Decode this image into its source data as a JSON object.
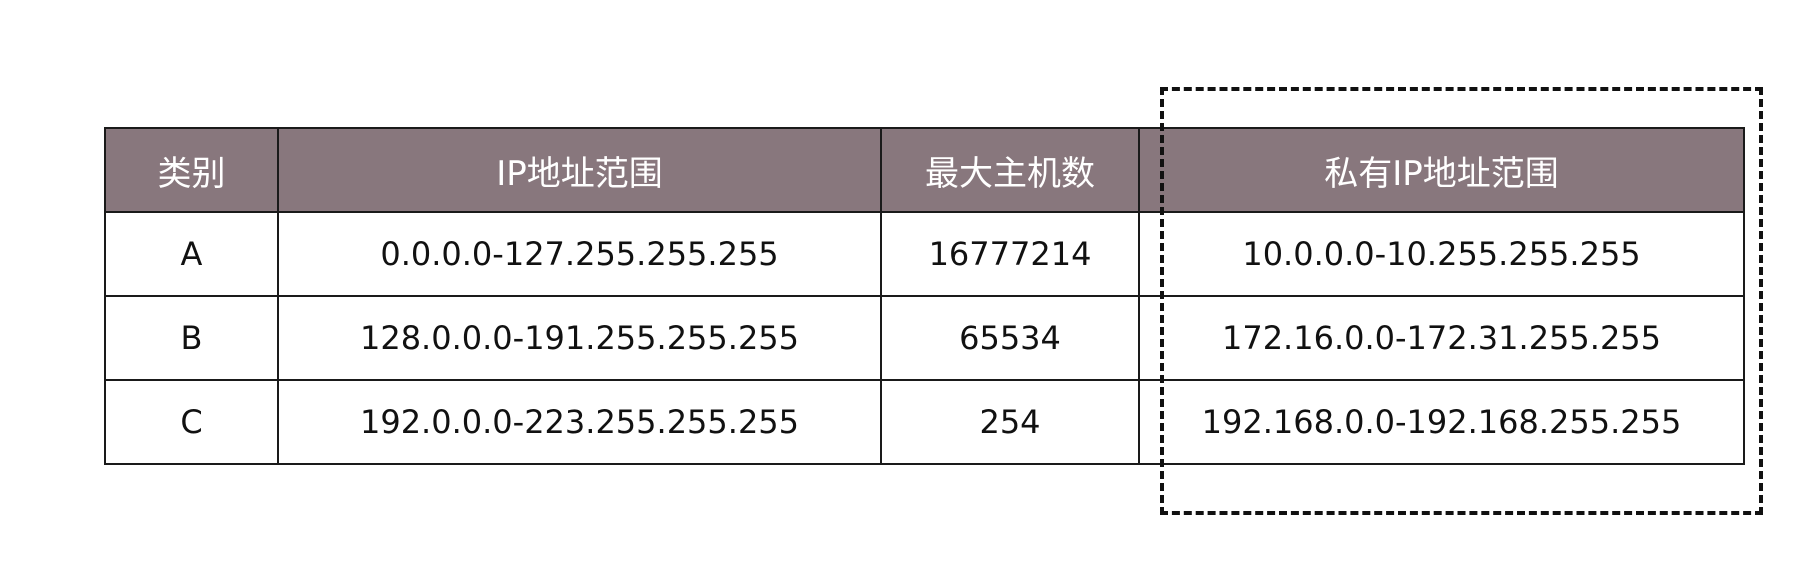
{
  "table": {
    "headers": [
      "类别",
      "IP地址范围",
      "最大主机数",
      "私有IP地址范围"
    ],
    "rows": [
      [
        "A",
        "0.0.0.0-127.255.255.255",
        "16777214",
        "10.0.0.0-10.255.255.255"
      ],
      [
        "B",
        "128.0.0.0-191.255.255.255",
        "65534",
        "172.16.0.0-172.31.255.255"
      ],
      [
        "C",
        "192.0.0.0-223.255.255.255",
        "254",
        "192.168.0.0-192.168.255.255"
      ]
    ]
  },
  "colors": {
    "header_background": "#88777d",
    "header_text": "#ffffff",
    "border": "#1a1a1a",
    "highlight_border": "#111111"
  }
}
